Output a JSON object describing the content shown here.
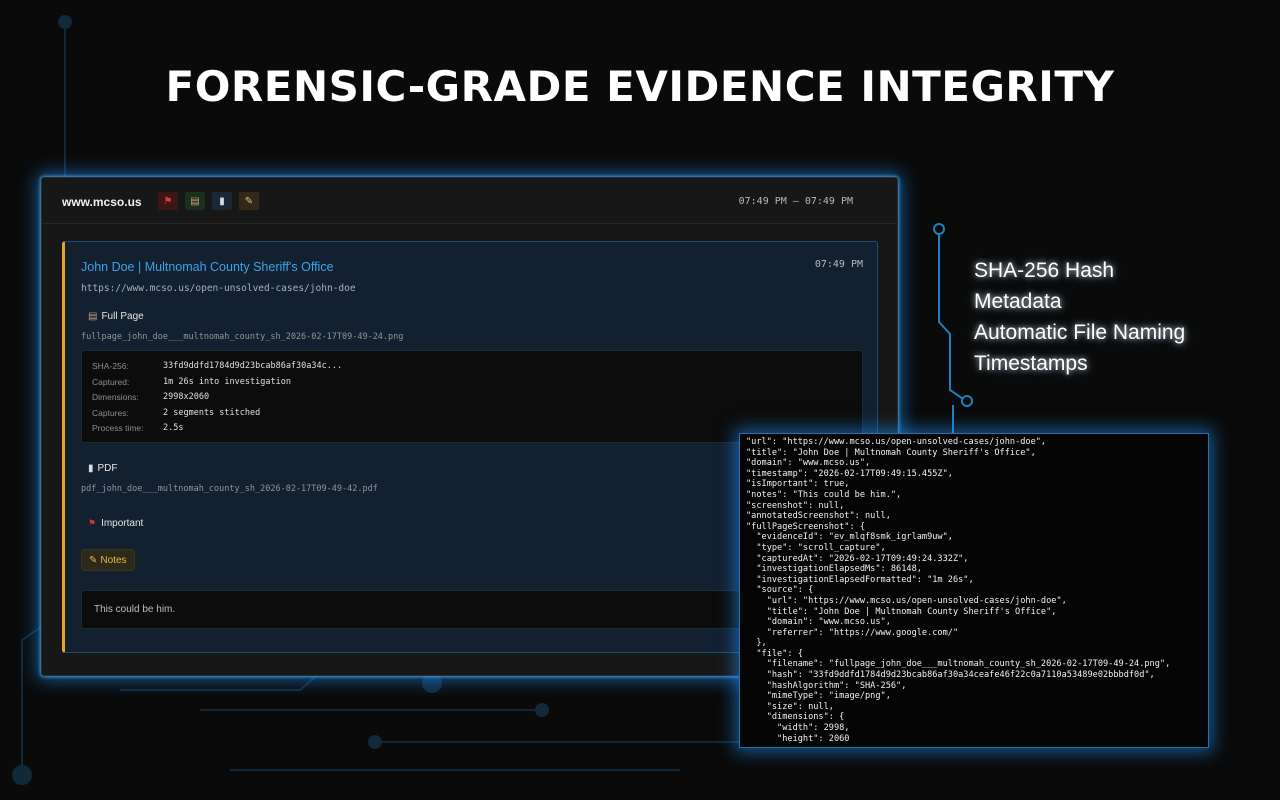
{
  "headline": "FORENSIC-GRADE EVIDENCE INTEGRITY",
  "features": [
    "SHA-256 Hash",
    "Metadata",
    "Automatic File Naming",
    "Timestamps"
  ],
  "panel": {
    "domain": "www.mcso.us",
    "time_range": "07:49 PM – 07:49 PM",
    "icons": [
      {
        "name": "flag-icon",
        "glyph": "⚑"
      },
      {
        "name": "page-icon",
        "glyph": "▤"
      },
      {
        "name": "document-icon",
        "glyph": "▮"
      },
      {
        "name": "notes-icon",
        "glyph": "✎"
      }
    ]
  },
  "card": {
    "title": "John Doe | Multnomah County Sheriff's Office",
    "time": "07:49 PM",
    "url": "https://www.mcso.us/open-unsolved-cases/john-doe",
    "fullpage": {
      "label": "Full Page",
      "filename": "fullpage_john_doe___multnomah_county_sh_2026-02-17T09-49-24.png",
      "meta": [
        {
          "key": "SHA-256:",
          "value": "33fd9ddfd1784d9d23bcab86af30a34c..."
        },
        {
          "key": "Captured:",
          "value": "1m 26s into investigation"
        },
        {
          "key": "Dimensions:",
          "value": "2998x2060"
        },
        {
          "key": "Captures:",
          "value": "2 segments stitched"
        },
        {
          "key": "Process time:",
          "value": "2.5s"
        }
      ]
    },
    "pdf": {
      "label": "PDF",
      "filename": "pdf_john_doe___multnomah_county_sh_2026-02-17T09-49-42.pdf"
    },
    "important_label": "Important",
    "notes_label": "Notes",
    "notes_text": "This could be him."
  },
  "json_lines": [
    "\"url\": \"https://www.mcso.us/open-unsolved-cases/john-doe\",",
    "\"title\": \"John Doe | Multnomah County Sheriff's Office\",",
    "\"domain\": \"www.mcso.us\",",
    "\"timestamp\": \"2026-02-17T09:49:15.455Z\",",
    "\"isImportant\": true,",
    "\"notes\": \"This could be him.\",",
    "\"screenshot\": null,",
    "\"annotatedScreenshot\": null,",
    "\"fullPageScreenshot\": {",
    "  \"evidenceId\": \"ev_mlqf8smk_igrlam9uw\",",
    "  \"type\": \"scroll_capture\",",
    "  \"capturedAt\": \"2026-02-17T09:49:24.332Z\",",
    "  \"investigationElapsedMs\": 86148,",
    "  \"investigationElapsedFormatted\": \"1m 26s\",",
    "  \"source\": {",
    "    \"url\": \"https://www.mcso.us/open-unsolved-cases/john-doe\",",
    "    \"title\": \"John Doe | Multnomah County Sheriff's Office\",",
    "    \"domain\": \"www.mcso.us\",",
    "    \"referrer\": \"https://www.google.com/\"",
    "  },",
    "  \"file\": {",
    "    \"filename\": \"fullpage_john_doe___multnomah_county_sh_2026-02-17T09-49-24.png\",",
    "    \"hash\": \"33fd9ddfd1784d9d23bcab86af30a34ceafe46f22c0a7110a53489e02bbbdf0d\",",
    "    \"hashAlgorithm\": \"SHA-256\",",
    "    \"mimeType\": \"image/png\",",
    "    \"size\": null,",
    "    \"dimensions\": {",
    "      \"width\": 2998,",
    "      \"height\": 2060"
  ]
}
